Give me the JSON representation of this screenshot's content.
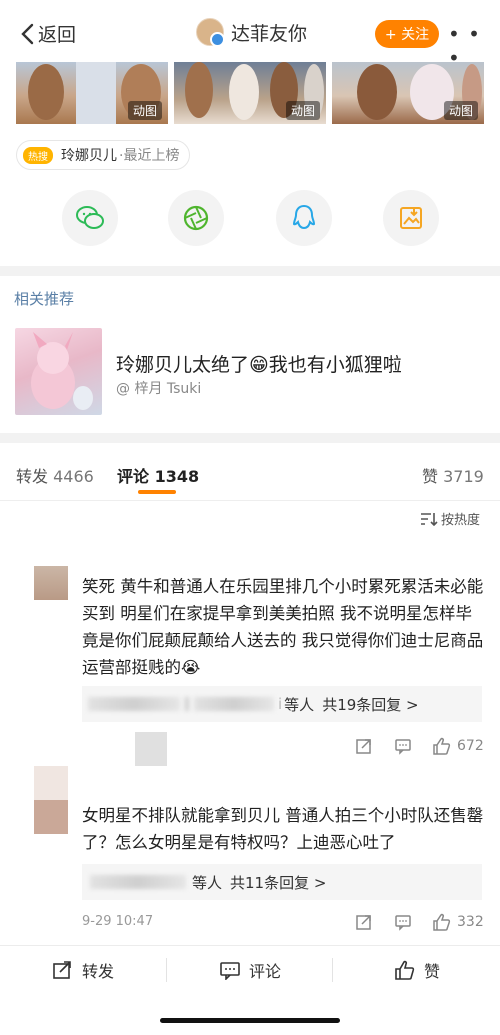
{
  "nav": {
    "back_label": "返回",
    "title": "达菲友你",
    "follow_label": "+ 关注",
    "more_label": "• • •"
  },
  "media": {
    "badge": "动图"
  },
  "hot_tag": {
    "badge": "热搜",
    "text": "玲娜贝儿",
    "sub": "·最近上榜"
  },
  "share_icons": [
    "wechat-icon",
    "moments-icon",
    "qq-icon",
    "save-image-icon"
  ],
  "related": {
    "label": "相关推荐",
    "title": "玲娜贝儿太绝了😁我也有小狐狸啦",
    "author": "@ 梓月 Tsuki"
  },
  "tabs": {
    "repost_label": "转发",
    "repost_count": "4466",
    "comment_label": "评论",
    "comment_count": "1348",
    "like_label": "赞",
    "like_count": "3719"
  },
  "sort": {
    "label": "按热度"
  },
  "comments": [
    {
      "text": "笑死 黄牛和普通人在乐园里排几个小时累死累活未必能买到 明星们在家提早拿到美美拍照 我不说明星怎样毕竟是你们屁颠屁颠给人送去的 我只觉得你们迪士尼商品运营部挺贱的😭",
      "reply_tail": "i",
      "reply_suffix": "等人",
      "reply_count": "共19条回复 >",
      "time": "",
      "likes": "672"
    },
    {
      "text": "女明星不排队就能拿到贝儿 普通人拍三个小时队还售罄了？怎么女明星是有特权吗？上迪恶心吐了",
      "reply_tail": "",
      "reply_suffix": "等人",
      "reply_count": "共11条回复 >",
      "time": "9-29 10:47",
      "likes": "332"
    }
  ],
  "bottom": {
    "repost": "转发",
    "comment": "评论",
    "like": "赞"
  },
  "colors": {
    "accent": "#ff8200",
    "link": "#5a7fa6",
    "hot": "#ffb400"
  }
}
